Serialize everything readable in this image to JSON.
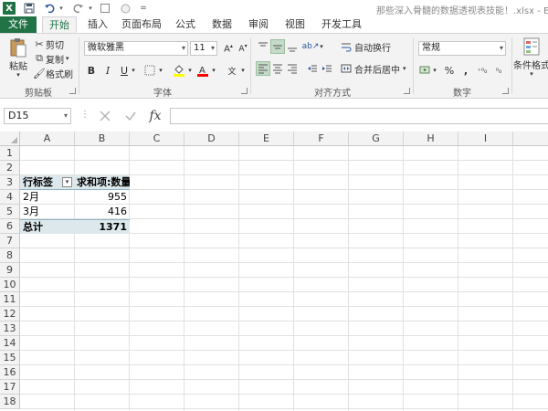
{
  "titlebar": {
    "logo": "X",
    "save_icon": "save-icon",
    "undo_icon": "undo-icon",
    "redo_icon": "redo-icon",
    "doc_title": "那些深入骨髓的数据透视表技能！.xlsx - Excel"
  },
  "tabs": [
    "文件",
    "开始",
    "插入",
    "页面布局",
    "公式",
    "数据",
    "审阅",
    "视图",
    "开发工具"
  ],
  "ribbon": {
    "clipboard": {
      "paste": "粘贴",
      "cut": "剪切",
      "copy": "复制",
      "format_painter": "格式刷",
      "label": "剪贴板"
    },
    "font": {
      "font_name": "微软雅黑",
      "font_size": "11",
      "bold": "B",
      "italic": "I",
      "underline": "U",
      "label": "字体"
    },
    "alignment": {
      "wrap": "自动换行",
      "merge": "合并后居中",
      "label": "对齐方式"
    },
    "number": {
      "format": "常规",
      "percent": "%",
      "comma": ",",
      "label": "数字"
    },
    "styles": {
      "conditional": "条件格式"
    }
  },
  "formula_bar": {
    "name_box": "D15",
    "fx": "fx",
    "value": ""
  },
  "sheet": {
    "columns": [
      "A",
      "B",
      "C",
      "D",
      "E",
      "F",
      "G",
      "H",
      "I"
    ],
    "rows": [
      "1",
      "2",
      "3",
      "4",
      "5",
      "6",
      "7",
      "8",
      "9",
      "10",
      "11",
      "12",
      "13",
      "14",
      "15",
      "16",
      "17",
      "18"
    ],
    "pivot": {
      "header_row": "行标签",
      "header_value": "求和项:数量",
      "rows": [
        {
          "label": "2月",
          "value": "955"
        },
        {
          "label": "3月",
          "value": "416"
        }
      ],
      "total_label": "总计",
      "total_value": "1371"
    }
  },
  "colors": {
    "accent": "#217346",
    "pivot_fill": "#dde8ec"
  }
}
